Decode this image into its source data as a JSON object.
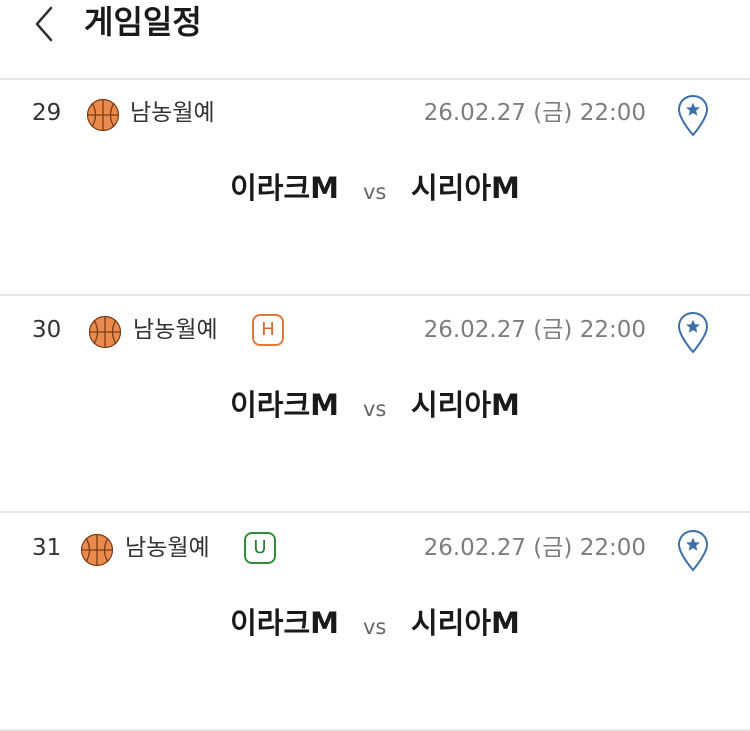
{
  "header": {
    "title": "게임일정"
  },
  "games": [
    {
      "num": "29",
      "league": "남농월예",
      "badge": "",
      "datetime": "26.02.27 (금) 22:00",
      "home": "이라크M",
      "vs": "vs",
      "away": "시리아M"
    },
    {
      "num": "30",
      "league": "남농월예",
      "badge": "H",
      "datetime": "26.02.27 (금) 22:00",
      "home": "이라크M",
      "vs": "vs",
      "away": "시리아M"
    },
    {
      "num": "31",
      "league": "남농월예",
      "badge": "U",
      "datetime": "26.02.27 (금) 22:00",
      "home": "이라크M",
      "vs": "vs",
      "away": "시리아M"
    }
  ],
  "icons": {
    "back": "chevron-left-icon",
    "sport": "basketball-icon",
    "pin": "map-pin-star-icon"
  },
  "colors": {
    "badge_h": "#d86a2a",
    "badge_u": "#2a7a36",
    "pin": "#3d6fa8"
  }
}
